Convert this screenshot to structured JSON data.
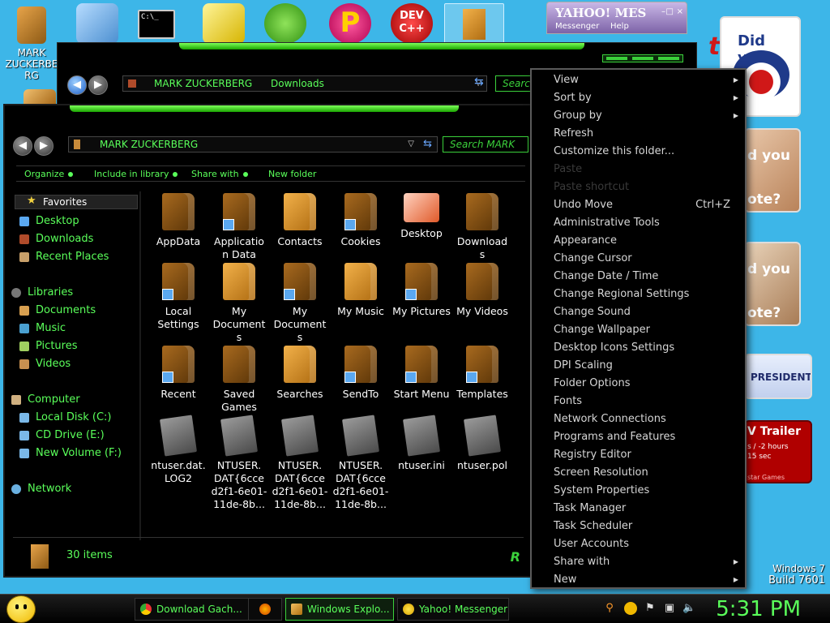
{
  "desktop": {
    "user_icon_label": "MARK ZUCKERBERG",
    "promo1_text": "Did you",
    "promo2_text": "d you",
    "promo2_sub": "ote?",
    "promo3_text": "d you",
    "promo3_sub": "ote?",
    "promo4_text": "PRESIDENT",
    "promo5_title": "V Trailer",
    "promo5_line1": "s / -2 hours",
    "promo5_line2": "15 sec",
    "promo5_line3": "star Games",
    "red_title_fragment": "t",
    "os_name": "Windows 7",
    "os_build": "Build 7601"
  },
  "messenger_window": {
    "logo": "YAHOO! MES",
    "menu_messenger": "Messenger",
    "menu_help": "Help"
  },
  "back_window": {
    "breadcrumb": [
      "MARK ZUCKERBERG",
      "Downloads"
    ],
    "search_placeholder": "Search"
  },
  "front_window": {
    "breadcrumb": [
      "MARK ZUCKERBERG"
    ],
    "search_placeholder": "Search MARK ZU",
    "toolbar": [
      "Organize",
      "Include in library",
      "Share with",
      "New folder"
    ],
    "nav": {
      "favorites": "Favorites",
      "favorites_items": [
        "Desktop",
        "Downloads",
        "Recent Places"
      ],
      "libraries": "Libraries",
      "libraries_items": [
        "Documents",
        "Music",
        "Pictures",
        "Videos"
      ],
      "computer": "Computer",
      "computer_items": [
        "Local Disk (C:)",
        "CD Drive (E:)",
        "New Volume (F:)"
      ],
      "network": "Network"
    },
    "files": [
      {
        "label": "AppData",
        "kind": "folder"
      },
      {
        "label": "Applicatio n Data",
        "kind": "folder-shortcut"
      },
      {
        "label": "Contacts",
        "kind": "folder-light"
      },
      {
        "label": "Cookies",
        "kind": "folder-shortcut"
      },
      {
        "label": "Desktop",
        "kind": "desktop"
      },
      {
        "label": "Download s",
        "kind": "folder"
      },
      {
        "label": "Local Settings",
        "kind": "folder-shortcut"
      },
      {
        "label": "My Document s",
        "kind": "folder-light"
      },
      {
        "label": "My Document s",
        "kind": "folder-shortcut"
      },
      {
        "label": "My Music",
        "kind": "folder-light"
      },
      {
        "label": "My Pictures",
        "kind": "folder-shortcut"
      },
      {
        "label": "My Videos",
        "kind": "folder"
      },
      {
        "label": "Recent",
        "kind": "folder-shortcut"
      },
      {
        "label": "Saved Games",
        "kind": "folder"
      },
      {
        "label": "Searches",
        "kind": "folder-light"
      },
      {
        "label": "SendTo",
        "kind": "folder-shortcut"
      },
      {
        "label": "Start Menu",
        "kind": "folder-shortcut"
      },
      {
        "label": "Templates",
        "kind": "folder-shortcut"
      },
      {
        "label": "ntuser.dat. LOG2",
        "kind": "doc"
      },
      {
        "label": "NTUSER. DAT{6cce d2f1-6e01- 11de-8b...",
        "kind": "doc"
      },
      {
        "label": "NTUSER. DAT{6cce d2f1-6e01- 11de-8b...",
        "kind": "doc"
      },
      {
        "label": "NTUSER. DAT{6cce d2f1-6e01- 11de-8b...",
        "kind": "doc"
      },
      {
        "label": "ntuser.ini",
        "kind": "doc"
      },
      {
        "label": "ntuser.pol",
        "kind": "doc"
      }
    ],
    "status_text": "30 items"
  },
  "context_menu": {
    "items": [
      {
        "label": "View",
        "submenu": true,
        "disabled": false,
        "shortcut": ""
      },
      {
        "label": "Sort by",
        "submenu": true,
        "disabled": false,
        "shortcut": ""
      },
      {
        "label": "Group by",
        "submenu": true,
        "disabled": false,
        "shortcut": ""
      },
      {
        "label": "Refresh",
        "submenu": false,
        "disabled": false,
        "shortcut": ""
      },
      {
        "label": "Customize this folder...",
        "submenu": false,
        "disabled": false,
        "shortcut": ""
      },
      {
        "label": "Paste",
        "submenu": false,
        "disabled": true,
        "shortcut": ""
      },
      {
        "label": "Paste shortcut",
        "submenu": false,
        "disabled": true,
        "shortcut": ""
      },
      {
        "label": "Undo Move",
        "submenu": false,
        "disabled": false,
        "shortcut": "Ctrl+Z"
      },
      {
        "label": "Administrative Tools",
        "submenu": false,
        "disabled": false,
        "shortcut": ""
      },
      {
        "label": "Appearance",
        "submenu": false,
        "disabled": false,
        "shortcut": ""
      },
      {
        "label": "Change Cursor",
        "submenu": false,
        "disabled": false,
        "shortcut": ""
      },
      {
        "label": "Change Date / Time",
        "submenu": false,
        "disabled": false,
        "shortcut": ""
      },
      {
        "label": "Change Regional Settings",
        "submenu": false,
        "disabled": false,
        "shortcut": ""
      },
      {
        "label": "Change Sound",
        "submenu": false,
        "disabled": false,
        "shortcut": ""
      },
      {
        "label": "Change Wallpaper",
        "submenu": false,
        "disabled": false,
        "shortcut": ""
      },
      {
        "label": "Desktop Icons Settings",
        "submenu": false,
        "disabled": false,
        "shortcut": ""
      },
      {
        "label": "DPI Scaling",
        "submenu": false,
        "disabled": false,
        "shortcut": ""
      },
      {
        "label": "Folder Options",
        "submenu": false,
        "disabled": false,
        "shortcut": ""
      },
      {
        "label": "Fonts",
        "submenu": false,
        "disabled": false,
        "shortcut": ""
      },
      {
        "label": "Network Connections",
        "submenu": false,
        "disabled": false,
        "shortcut": ""
      },
      {
        "label": "Programs and Features",
        "submenu": false,
        "disabled": false,
        "shortcut": ""
      },
      {
        "label": "Registry Editor",
        "submenu": false,
        "disabled": false,
        "shortcut": ""
      },
      {
        "label": "Screen Resolution",
        "submenu": false,
        "disabled": false,
        "shortcut": ""
      },
      {
        "label": "System Properties",
        "submenu": false,
        "disabled": false,
        "shortcut": ""
      },
      {
        "label": "Task Manager",
        "submenu": false,
        "disabled": false,
        "shortcut": ""
      },
      {
        "label": "Task Scheduler",
        "submenu": false,
        "disabled": false,
        "shortcut": ""
      },
      {
        "label": "User Accounts",
        "submenu": false,
        "disabled": false,
        "shortcut": ""
      },
      {
        "label": "Share with",
        "submenu": true,
        "disabled": false,
        "shortcut": ""
      },
      {
        "label": "New",
        "submenu": true,
        "disabled": false,
        "shortcut": ""
      }
    ]
  },
  "taskbar": {
    "tasks": [
      {
        "label": "Download Gach...",
        "icon": "chrome-icon"
      },
      {
        "label": "",
        "icon": "firefox-icon"
      },
      {
        "label": "Windows Explo...",
        "icon": "folder-icon"
      },
      {
        "label": "Yahoo! Messenger",
        "icon": "yahoo-messenger-icon"
      }
    ],
    "clock": "5:31 PM"
  },
  "colors": {
    "accent_green": "#5aff5a",
    "desktop_blue": "#3db6e8",
    "menu_text": "#d6d6d6"
  }
}
